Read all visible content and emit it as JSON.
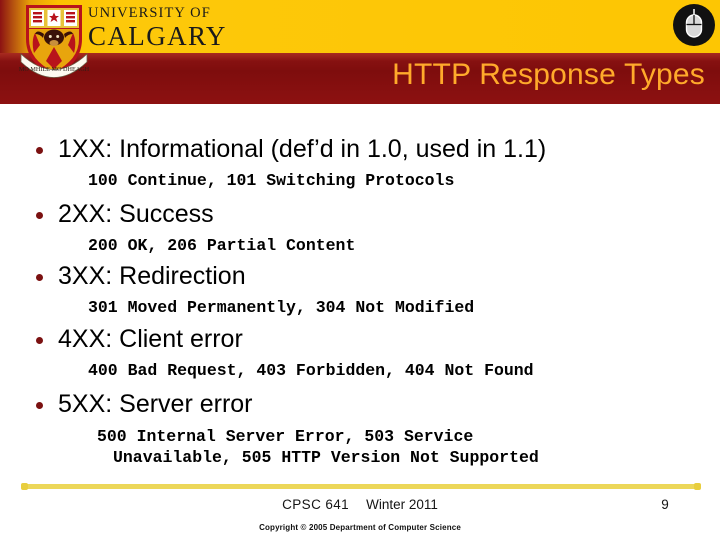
{
  "header": {
    "title": "HTTP Response Types",
    "title_color": "#ffaa2b",
    "band_color": "#fdc603",
    "red_color": "#8b1111",
    "university_line1": "UNIVERSITY OF",
    "university_line2": "CALGARY",
    "crest_motto": "MO MHILE MO DHEAGH SGIAS",
    "crest_icon": "university-crest-icon",
    "mouse_icon": "computer-mouse-icon"
  },
  "body": {
    "bullet_color": "#7b1111",
    "groups": [
      {
        "heading": "1XX: Informational (def’d in 1.0, used in 1.1)",
        "codes": [
          "100 Continue, 101 Switching Protocols"
        ]
      },
      {
        "heading": "2XX: Success",
        "codes": [
          "200 OK, 206 Partial Content"
        ]
      },
      {
        "heading": "3XX: Redirection",
        "codes": [
          "301 Moved Permanently, 304 Not Modified"
        ]
      },
      {
        "heading": "4XX: Client error",
        "codes": [
          "400 Bad Request, 403 Forbidden, 404 Not Found"
        ]
      },
      {
        "heading": "5XX: Server error",
        "codes": [
          "500 Internal Server Error, 503 Service",
          "Unavailable, 505 HTTP Version Not Supported"
        ]
      }
    ]
  },
  "footer": {
    "course": "CPSC 641",
    "term": "Winter 2011",
    "page_number": "9",
    "copyright": "Copyright © 2005 Department of Computer Science",
    "rule_color": "#ecd759"
  }
}
